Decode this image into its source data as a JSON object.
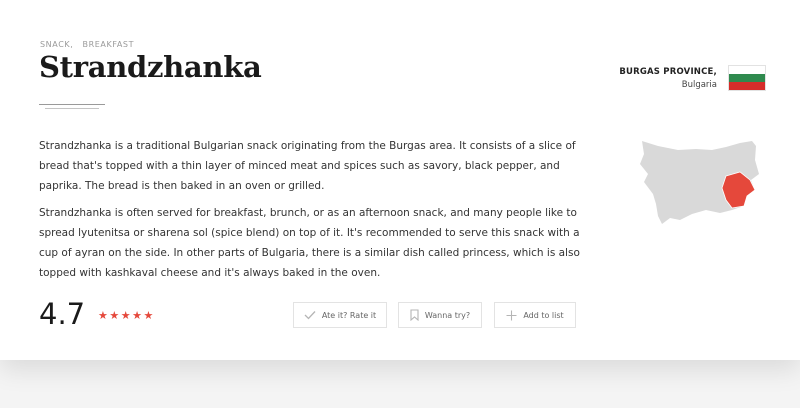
{
  "tags": [
    "SNACK,",
    "BREAKFAST"
  ],
  "title": "Strandzhanka",
  "region": {
    "province": "BURGAS PROVINCE,",
    "country": "Bulgaria"
  },
  "flag_colors": [
    "#ffffff",
    "#2f8a4e",
    "#d62d2a"
  ],
  "map_colors": {
    "country": "#d9d9d9",
    "highlight": "#e5483b"
  },
  "description": [
    "Strandzhanka is a traditional Bulgarian snack originating from the Burgas area. It consists of a slice of bread that's topped with a thin layer of minced meat and spices such as savory, black pepper, and paprika. The bread is then baked in an oven or grilled.",
    "Strandzhanka is often served for breakfast, brunch, or as an afternoon snack, and many people like to spread lyutenitsa or sharena sol (spice blend) on top of it. It's recommended to serve this snack with a cup of ayran on the side. In other parts of Bulgaria, there is a similar dish called princess, which is also topped with kashkaval cheese and it's always baked in the oven."
  ],
  "rating": {
    "value": "4.7",
    "stars": "★★★★★"
  },
  "actions": {
    "rate": "Ate it? Rate it",
    "wanna": "Wanna try?",
    "add": "Add to list"
  }
}
